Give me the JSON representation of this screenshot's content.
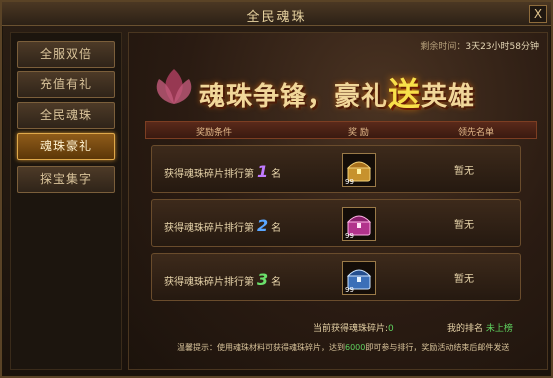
{
  "window": {
    "title": "全民魂珠",
    "close_label": "X"
  },
  "sidebar": {
    "items": [
      {
        "label": "全服双倍",
        "active": false
      },
      {
        "label": "充值有礼",
        "active": false
      },
      {
        "label": "全民魂珠",
        "active": false
      },
      {
        "label": "魂珠豪礼",
        "active": true
      },
      {
        "label": "探宝集字",
        "active": false
      }
    ]
  },
  "content": {
    "countdown_label": "剩余时间：",
    "countdown_value": "3天23小时58分钟",
    "banner": {
      "part1": "魂珠争锋，豪礼",
      "big": "送",
      "part2": "英雄"
    },
    "table": {
      "headers": {
        "condition": "奖励条件",
        "reward": "奖 励",
        "leaders": "领先名单"
      },
      "rows": [
        {
          "prefix": "获得魂珠碎片排行第",
          "rank": "1",
          "suffix": "名",
          "chest_color": "#c7922d",
          "count": "99",
          "leader": "暂无"
        },
        {
          "prefix": "获得魂珠碎片排行第",
          "rank": "2",
          "suffix": "名",
          "chest_color": "#b1338c",
          "count": "99",
          "leader": "暂无"
        },
        {
          "prefix": "获得魂珠碎片排行第",
          "rank": "3",
          "suffix": "名",
          "chest_color": "#3b6fb8",
          "count": "99",
          "leader": "暂无"
        }
      ]
    },
    "footer": {
      "fragments_label": "当前获得魂珠碎片:",
      "fragments_value": "0",
      "my_rank_label": "我的排名",
      "my_rank_value": "未上榜"
    },
    "hint": {
      "label": "温馨提示：",
      "text_before": "使用魂珠材料可获得魂珠碎片，达到",
      "threshold": "6000",
      "text_after": "即可参与排行，奖励活动结束后邮件发送"
    }
  }
}
